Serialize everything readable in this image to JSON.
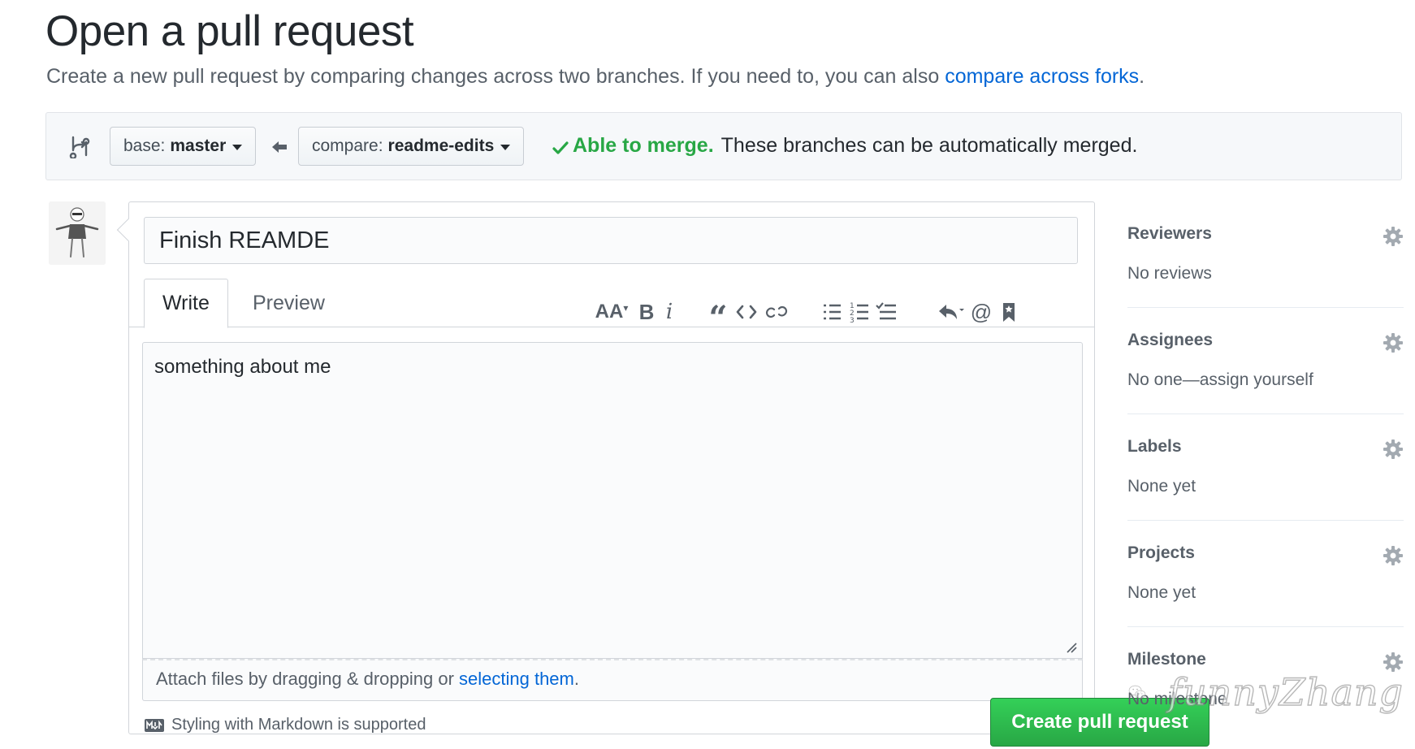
{
  "header": {
    "title": "Open a pull request",
    "subtitle_prefix": "Create a new pull request by comparing changes across two branches. If you need to, you can also ",
    "subtitle_link": "compare across forks",
    "subtitle_suffix": "."
  },
  "range": {
    "base_label": "base:",
    "base_value": "master",
    "compare_label": "compare:",
    "compare_value": "readme-edits",
    "merge_ok": "Able to merge.",
    "merge_text": "These branches can be automatically merged."
  },
  "form": {
    "title_value": "Finish REAMDE",
    "tab_write": "Write",
    "tab_preview": "Preview",
    "body_value": "something about me",
    "attach_prefix": "Attach files by dragging & dropping or ",
    "attach_link": "selecting them",
    "attach_suffix": ".",
    "markdown_note": "Styling with Markdown is supported",
    "create_button": "Create pull request",
    "toolbar": {
      "header_glyph": "AA",
      "bold_glyph": "B",
      "italic_glyph": "i",
      "quote_glyph": "“",
      "mention_glyph": "@"
    }
  },
  "sidebar": {
    "sections": [
      {
        "heading": "Reviewers",
        "value": "No reviews"
      },
      {
        "heading": "Assignees",
        "value": "No one—assign yourself"
      },
      {
        "heading": "Labels",
        "value": "None yet"
      },
      {
        "heading": "Projects",
        "value": "None yet"
      },
      {
        "heading": "Milestone",
        "value": "No milestone"
      }
    ]
  },
  "watermark": {
    "text": "funnyZhang"
  },
  "colors": {
    "link": "#0366d6",
    "success": "#28a745",
    "text_muted": "#586069"
  },
  "icons": [
    "git-compare-icon",
    "arrow-left-icon",
    "check-icon",
    "text-size-icon",
    "bold-icon",
    "italic-icon",
    "quote-icon",
    "code-icon",
    "link-icon",
    "unordered-list-icon",
    "ordered-list-icon",
    "task-list-icon",
    "reply-icon",
    "mention-icon",
    "bookmark-icon",
    "markdown-icon",
    "gear-icon",
    "wechat-icon"
  ]
}
